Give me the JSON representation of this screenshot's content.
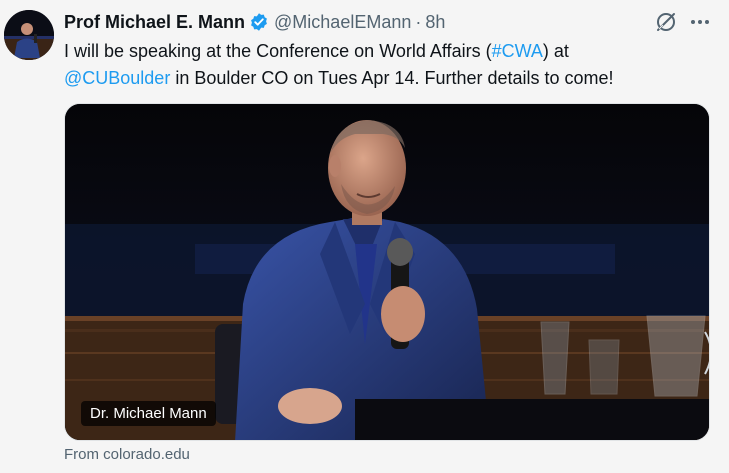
{
  "tweet": {
    "author_name": "Prof Michael E. Mann",
    "handle": "@MichaelEMann",
    "separator": "·",
    "time": "8h",
    "text_part1": "I will be speaking at the Conference on World Affairs (",
    "hashtag": "#CWA",
    "text_part2": ") at",
    "mention": "@CUBoulder",
    "text_part3": " in Boulder CO on Tues Apr 14.  Further details to come!",
    "media_caption": "Dr. Michael Mann",
    "source": "From colorado.edu"
  },
  "icons": {
    "verified": "verified-badge-icon",
    "grok": "grok-icon",
    "more": "more-horizontal-icon"
  },
  "colors": {
    "accent": "#1d9bf0",
    "text_primary": "#0f1419",
    "text_secondary": "#536471",
    "background": "#f5f5f5"
  }
}
